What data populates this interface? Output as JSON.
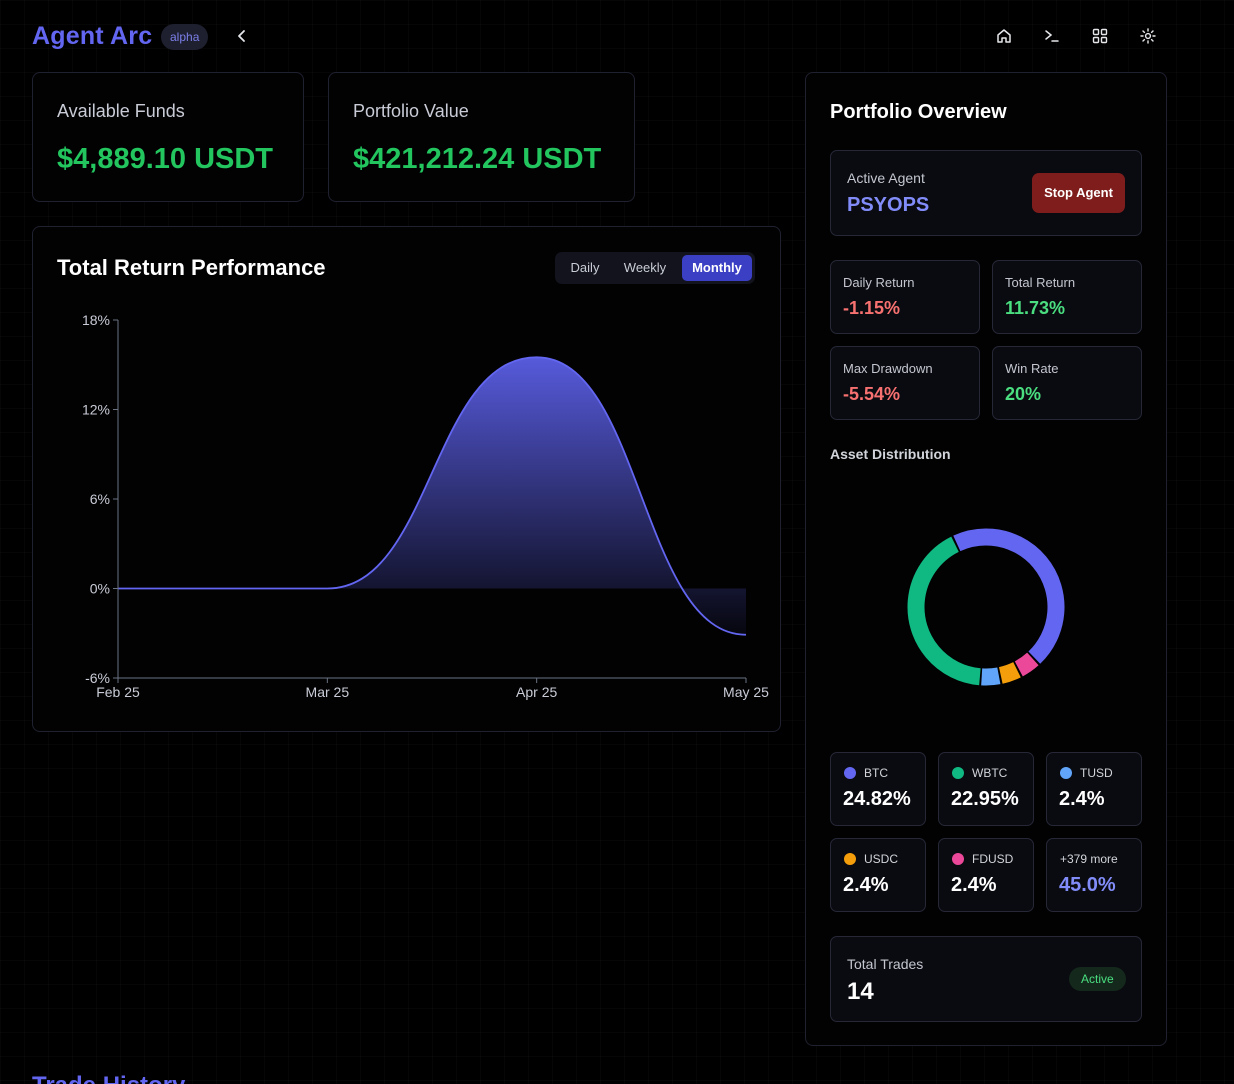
{
  "header": {
    "brand": "Agent Arc",
    "badge": "alpha",
    "icons": [
      "chevron-left-icon",
      "home-icon",
      "terminal-icon",
      "grid-icon",
      "gear-icon"
    ]
  },
  "funds": {
    "label": "Available Funds",
    "value": "$4,889.10 USDT"
  },
  "portfolio_value": {
    "label": "Portfolio Value",
    "value": "$421,212.24 USDT"
  },
  "performance": {
    "title": "Total Return Performance",
    "tabs": [
      "Daily",
      "Weekly",
      "Monthly"
    ],
    "active_tab": "Monthly"
  },
  "chart_data": {
    "type": "area",
    "x": [
      "Feb 25",
      "Mar 25",
      "Apr 25",
      "May 25"
    ],
    "y": [
      0,
      0,
      15.5,
      -3.1
    ],
    "series": [
      {
        "values": [
          0,
          0,
          15.5,
          -3.1
        ]
      }
    ],
    "ylim": [
      -6,
      18
    ],
    "yticks": [
      "18%",
      "12%",
      "6%",
      "0%",
      "-6%"
    ],
    "xlabel": "",
    "ylabel": "",
    "grid": false
  },
  "overview": {
    "title": "Portfolio Overview",
    "agent_label": "Active Agent",
    "agent_name": "PSYOPS",
    "stop_label": "Stop Agent",
    "metrics": [
      {
        "label": "Daily Return",
        "value": "-1.15%",
        "tone": "red"
      },
      {
        "label": "Total Return",
        "value": "11.73%",
        "tone": "green"
      },
      {
        "label": "Max Drawdown",
        "value": "-5.54%",
        "tone": "red"
      },
      {
        "label": "Win Rate",
        "value": "20%",
        "tone": "green"
      }
    ],
    "asset_title": "Asset Distribution",
    "assets": [
      {
        "name": "BTC",
        "value": "24.82%",
        "pct": 24.82,
        "color": "#6366f1"
      },
      {
        "name": "WBTC",
        "value": "22.95%",
        "pct": 22.95,
        "color": "#10b981"
      },
      {
        "name": "TUSD",
        "value": "2.4%",
        "pct": 2.4,
        "color": "#60a5fa"
      },
      {
        "name": "USDC",
        "value": "2.4%",
        "pct": 2.4,
        "color": "#f59e0b"
      },
      {
        "name": "FDUSD",
        "value": "2.4%",
        "pct": 2.4,
        "color": "#ec4899"
      }
    ],
    "more": {
      "name": "+379 more",
      "value": "45.0%"
    },
    "trades_label": "Total Trades",
    "trades_count": "14",
    "trades_status": "Active"
  },
  "footer_heading": "Trade History"
}
